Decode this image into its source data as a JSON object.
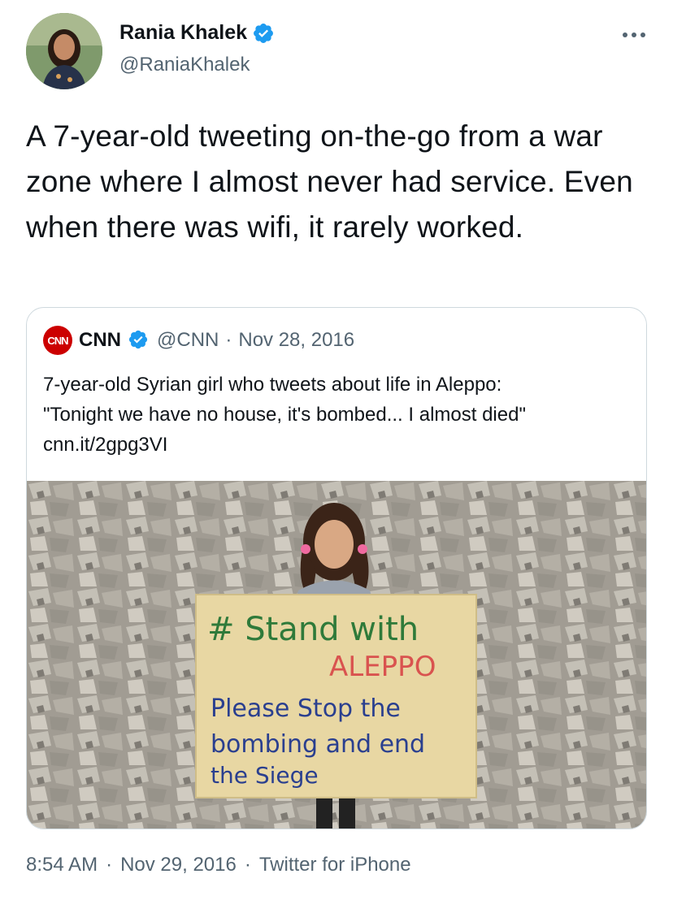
{
  "author": {
    "display_name": "Rania Khalek",
    "handle": "@RaniaKhalek",
    "verified_badge_color": "#1d9bf0"
  },
  "tweet": {
    "text": "A 7-year-old tweeting on-the-go from a war zone where I almost never had service. Even when there was wifi, it rarely worked."
  },
  "quoted_tweet": {
    "logo_text": "CNN",
    "display_name": "CNN",
    "handle": "@CNN",
    "separator": "·",
    "date": "Nov 28, 2016",
    "text_line1": "7-year-old Syrian girl who tweets about life in Aleppo:",
    "text_line2": "\"Tonight we have no house, it's bombed... I almost died\"",
    "link": "cnn.it/2gpg3VI",
    "image_sign": {
      "line1": "# Stand with",
      "line2": "ALEPPO",
      "line3": "Please Stop the",
      "line4": "bombing and end",
      "line5": "the Siege"
    }
  },
  "footer": {
    "time": "8:54 AM",
    "sep1": "·",
    "date": "Nov 29, 2016",
    "sep2": "·",
    "source": "Twitter for iPhone"
  },
  "colors": {
    "text_primary": "#0f1419",
    "text_secondary": "#536471",
    "border": "#cfd9de",
    "cnn_red": "#cc0000"
  },
  "icons": {
    "more": "more-horizontal-icon",
    "verified": "verified-badge-icon"
  }
}
